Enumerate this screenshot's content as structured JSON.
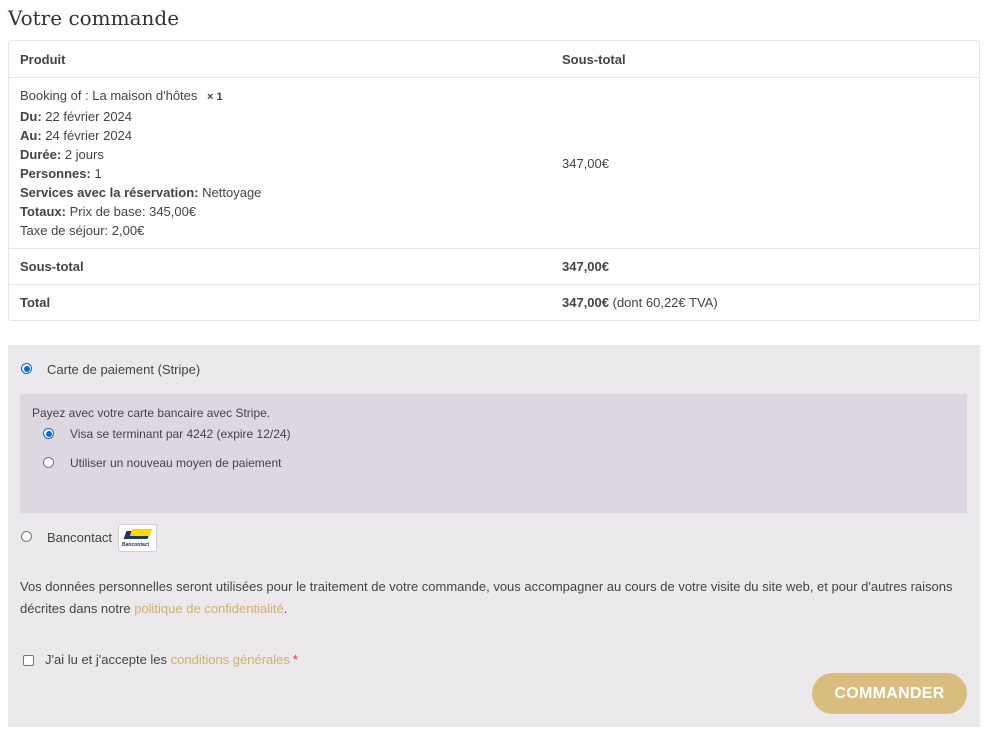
{
  "order": {
    "title": "Votre commande",
    "headers": {
      "product": "Produit",
      "subtotal": "Sous-total"
    },
    "item": {
      "booking_label": "Booking of :",
      "booking_value": "La maison d'hôtes",
      "quantity": "× 1",
      "from_label": "Du:",
      "from_value": "22 février 2024",
      "to_label": "Au:",
      "to_value": "24 février 2024",
      "duration_label": "Durée:",
      "duration_value": "2 jours",
      "persons_label": "Personnes:",
      "persons_value": "1",
      "services_label": "Services avec la réservation:",
      "services_value": "Nettoyage",
      "totals_label": "Totaux:",
      "totals_value": "Prix de base: 345,00€",
      "tax_line": "Taxe de séjour: 2,00€",
      "price": "347,00€"
    },
    "subtotal_label": "Sous-total",
    "subtotal_value": "347,00€",
    "total_label": "Total",
    "total_value": "347,00€",
    "total_tax_note": "(dont 60,22€ TVA)"
  },
  "payment": {
    "stripe_label": "Carte de paiement (Stripe)",
    "stripe_description": "Payez avec votre carte bancaire avec Stripe.",
    "saved_card_label": "Visa se terminant par 4242 (expire 12/24)",
    "new_method_label": "Utiliser un nouveau moyen de paiement",
    "bancontact_label": "Bancontact",
    "bancontact_logo_text": "Bancontact",
    "privacy_text": "Vos données personnelles seront utilisées pour le traitement de votre commande, vous accompagner au cours de votre visite du site web, et pour d'autres raisons décrites dans notre ",
    "privacy_link": "politique de confidentialité",
    "privacy_end": ".",
    "terms_text": "J'ai lu et j'accepte les ",
    "terms_link": "conditions générales",
    "terms_required": "*",
    "submit_label": "COMMANDER"
  },
  "colors": {
    "accent": "#d9bd7e",
    "link": "#d4b06a",
    "payment_bg": "#ebe9eb",
    "stripe_bg": "#dcd7e1",
    "radio_checked": "#0a66d9"
  }
}
